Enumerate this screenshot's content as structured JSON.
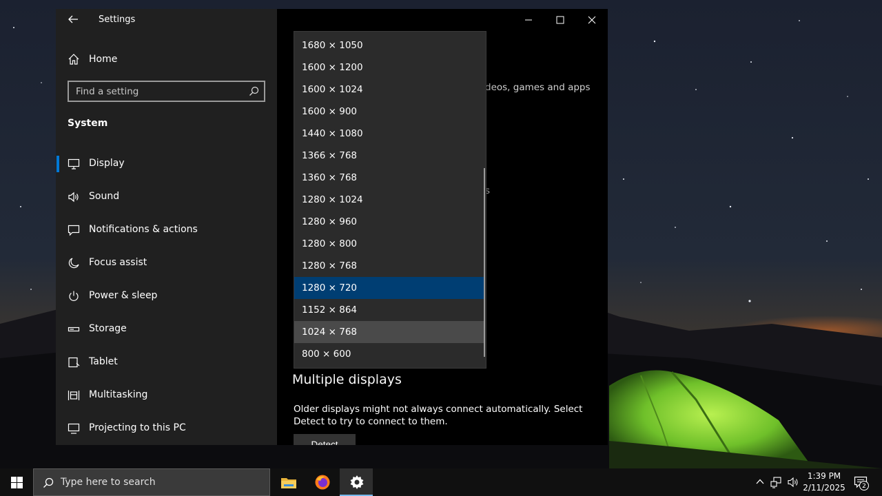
{
  "window": {
    "title": "Settings",
    "back_icon": "back-arrow-icon",
    "controls": [
      "minimize-icon",
      "maximize-icon",
      "close-icon"
    ]
  },
  "sidebar": {
    "home_label": "Home",
    "search_placeholder": "Find a setting",
    "section_title": "System",
    "items": [
      {
        "label": "Display",
        "icon": "monitor-icon",
        "selected": true
      },
      {
        "label": "Sound",
        "icon": "speaker-icon"
      },
      {
        "label": "Notifications & actions",
        "icon": "message-icon"
      },
      {
        "label": "Focus assist",
        "icon": "moon-icon"
      },
      {
        "label": "Power & sleep",
        "icon": "power-icon"
      },
      {
        "label": "Storage",
        "icon": "storage-icon"
      },
      {
        "label": "Tablet",
        "icon": "tablet-icon"
      },
      {
        "label": "Multitasking",
        "icon": "multitasking-icon"
      },
      {
        "label": "Projecting to this PC",
        "icon": "projecting-icon"
      }
    ]
  },
  "content": {
    "fragment_text": "deos, games and apps",
    "fragment_text2": "s",
    "multiple_displays_heading": "Multiple displays",
    "multiple_displays_desc": "Older displays might not always connect automatically. Select Detect to try to connect to them.",
    "detect_label": "Detect"
  },
  "resolution_dropdown": {
    "options": [
      "1680 × 1050",
      "1600 × 1200",
      "1600 × 1024",
      "1600 × 900",
      "1440 × 1080",
      "1366 × 768",
      "1360 × 768",
      "1280 × 1024",
      "1280 × 960",
      "1280 × 800",
      "1280 × 768",
      "1280 × 720",
      "1152 × 864",
      "1024 × 768",
      "800 × 600"
    ],
    "selected": "1280 × 720",
    "hovered": "1024 × 768"
  },
  "taskbar": {
    "search_placeholder": "Type here to search",
    "apps": [
      "file-explorer-icon",
      "firefox-icon",
      "settings-gear-icon"
    ],
    "active_app": "settings-gear-icon",
    "time": "1:39 PM",
    "date": "2/11/2025",
    "notification_count": "2",
    "accent_color": "#0078d7"
  }
}
